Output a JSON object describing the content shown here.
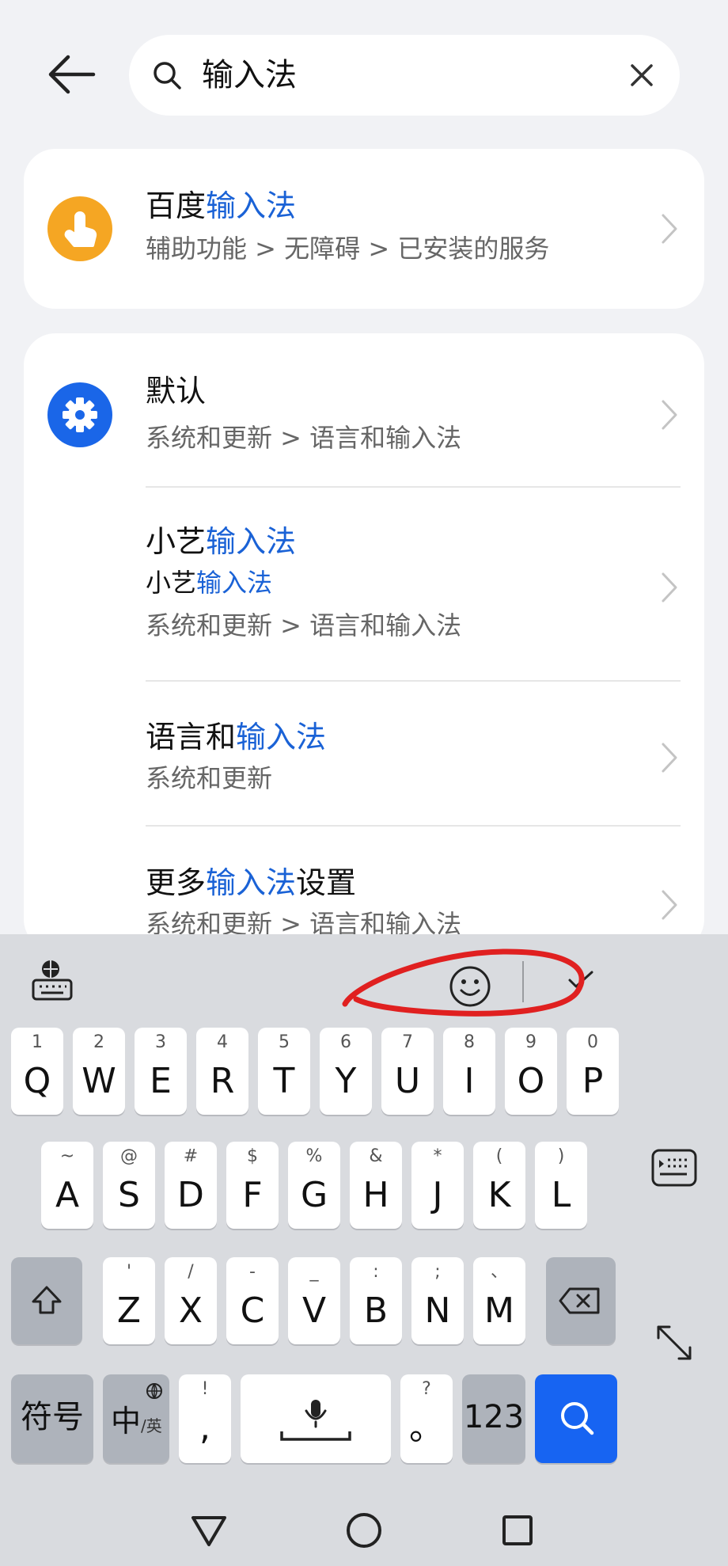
{
  "search": {
    "query": "输入法"
  },
  "results": [
    {
      "title_pre": "百度",
      "title_hl": "输入法",
      "title_post": "",
      "path": "辅助功能 > 无障碍 > 已安装的服务",
      "icon_color": "#f5a623",
      "icon": "touch-hand-icon"
    },
    {
      "title_pre": "默认",
      "title_hl": "",
      "title_post": "",
      "path": "系统和更新 > 语言和输入法",
      "icon_color": "#1a66e8",
      "icon": "gear-icon"
    },
    {
      "title_pre": "小艺",
      "title_hl": "输入法",
      "title_post": "",
      "sub_pre": "小艺",
      "sub_hl": "输入法",
      "path": "系统和更新 > 语言和输入法"
    },
    {
      "title_pre": "语言和",
      "title_hl": "输入法",
      "title_post": "",
      "path": "系统和更新"
    },
    {
      "title_pre": "更多",
      "title_hl": "输入法",
      "title_post": "设置",
      "path": "系统和更新 > 语言和输入法"
    }
  ],
  "keyboard": {
    "row1": [
      {
        "alt": "1",
        "main": "Q"
      },
      {
        "alt": "2",
        "main": "W"
      },
      {
        "alt": "3",
        "main": "E"
      },
      {
        "alt": "4",
        "main": "R"
      },
      {
        "alt": "5",
        "main": "T"
      },
      {
        "alt": "6",
        "main": "Y"
      },
      {
        "alt": "7",
        "main": "U"
      },
      {
        "alt": "8",
        "main": "I"
      },
      {
        "alt": "9",
        "main": "O"
      },
      {
        "alt": "0",
        "main": "P"
      }
    ],
    "row2": [
      {
        "alt": "~",
        "main": "A"
      },
      {
        "alt": "@",
        "main": "S"
      },
      {
        "alt": "#",
        "main": "D"
      },
      {
        "alt": "$",
        "main": "F"
      },
      {
        "alt": "%",
        "main": "G"
      },
      {
        "alt": "&",
        "main": "H"
      },
      {
        "alt": "*",
        "main": "J"
      },
      {
        "alt": "(",
        "main": "K"
      },
      {
        "alt": ")",
        "main": "L"
      }
    ],
    "row3": [
      {
        "alt": "'",
        "main": "Z"
      },
      {
        "alt": "/",
        "main": "X"
      },
      {
        "alt": "-",
        "main": "C"
      },
      {
        "alt": "_",
        "main": "V"
      },
      {
        "alt": ":",
        "main": "B"
      },
      {
        "alt": ";",
        "main": "N"
      },
      {
        "alt": "、",
        "main": "M"
      }
    ],
    "symbols_label": "符号",
    "lang_main": "中",
    "lang_sub": "/英",
    "comma_alt": "!",
    "comma_main": ",",
    "period_alt": "?",
    "period_main": "。",
    "num_label": "123",
    "accent_color": "#1764f2"
  }
}
